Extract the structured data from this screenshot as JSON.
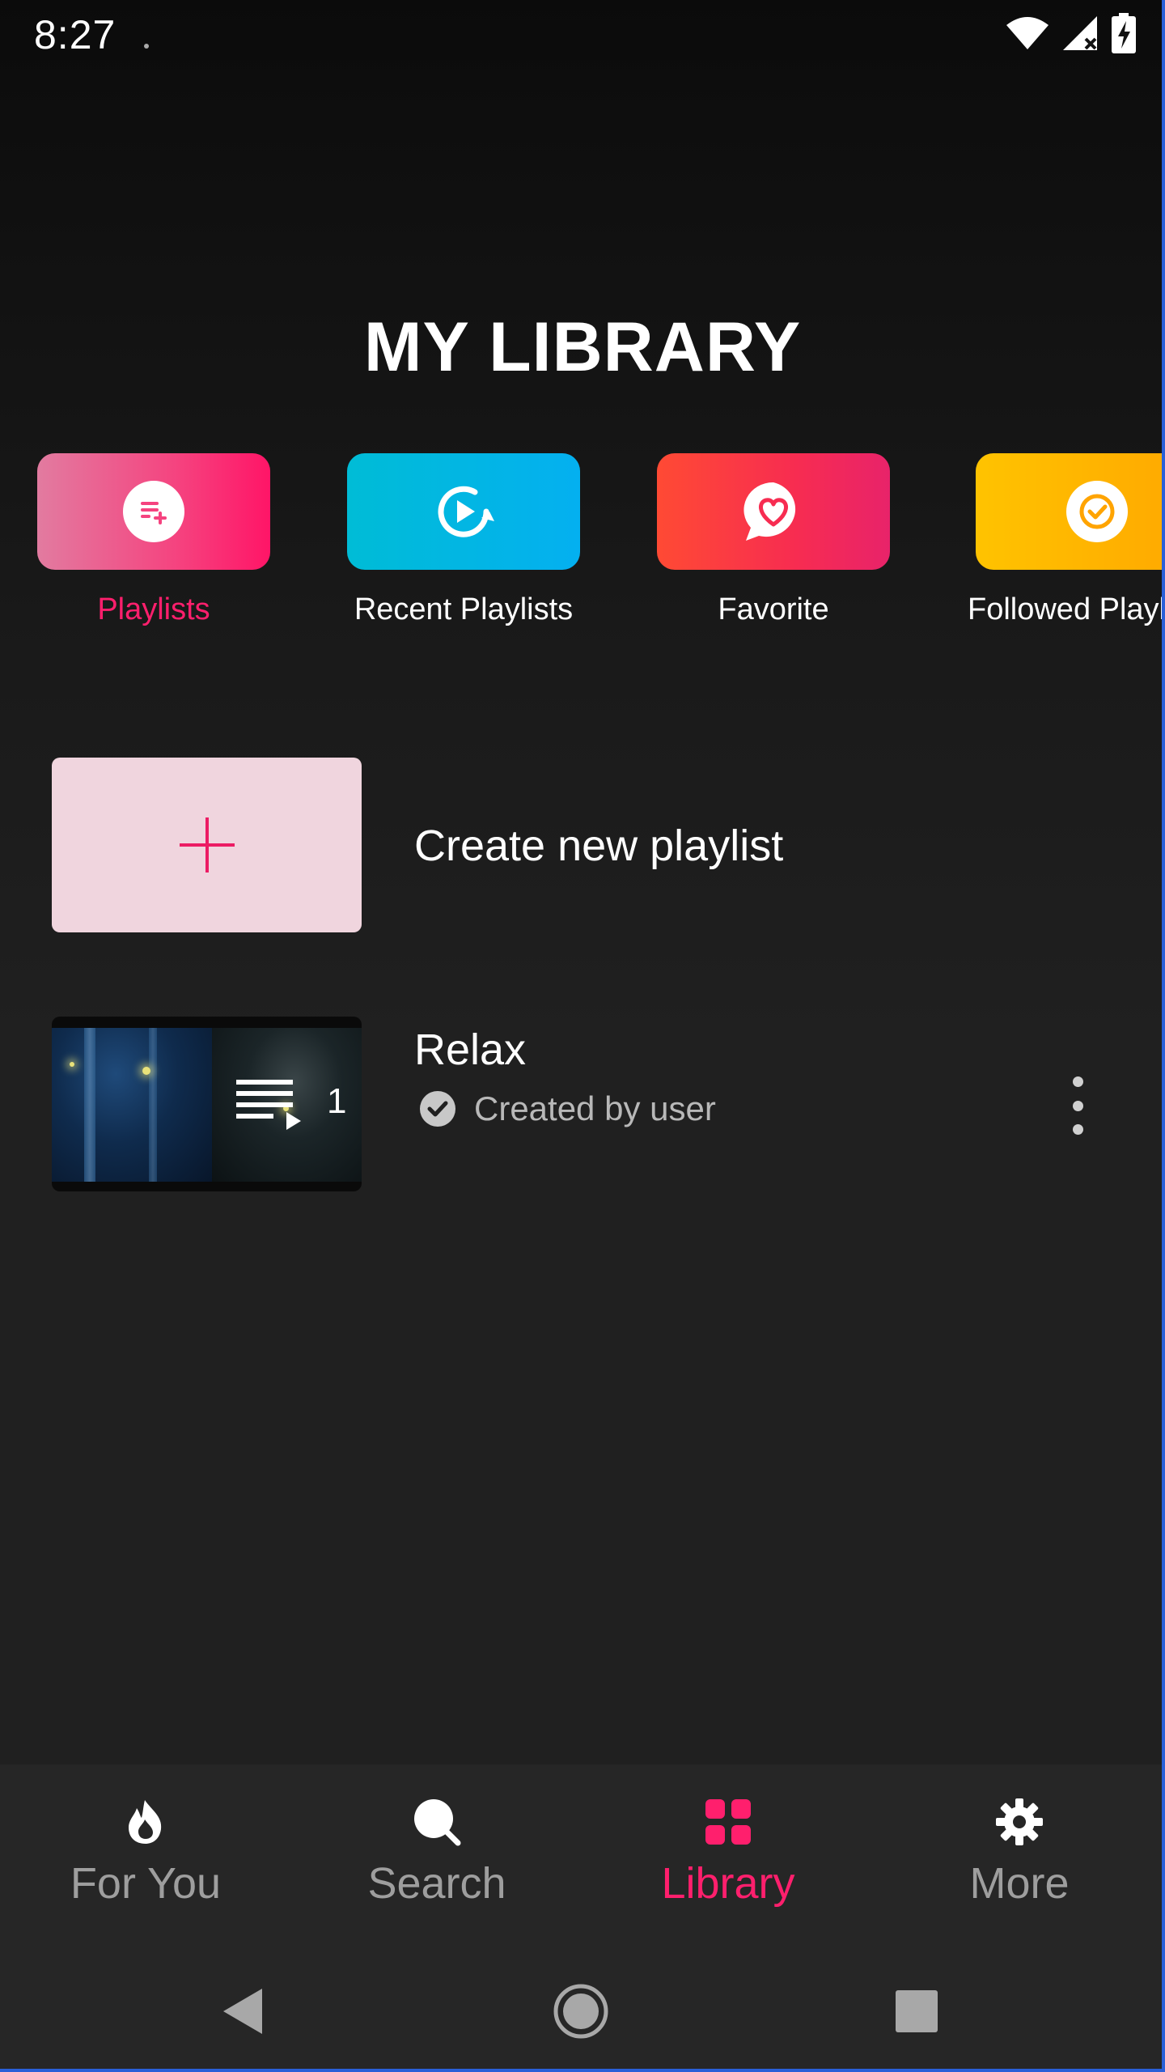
{
  "status_bar": {
    "time": "8:27",
    "icons": [
      "wifi-icon",
      "signal-icon",
      "battery-charging-icon"
    ]
  },
  "header": {
    "title": "MY LIBRARY"
  },
  "categories": [
    {
      "label": "Playlists",
      "icon": "playlist-add-icon",
      "active": true,
      "color": "#ff1f6d"
    },
    {
      "label": "Recent Playlists",
      "icon": "recent-play-icon",
      "active": false,
      "color": "#04b0f0"
    },
    {
      "label": "Favorite",
      "icon": "heart-chat-icon",
      "active": false,
      "color": "#f72c51"
    },
    {
      "label": "Followed Playl",
      "icon": "check-circle-icon",
      "active": false,
      "color": "#ffa400"
    }
  ],
  "create_playlist": {
    "label": "Create new playlist",
    "icon": "plus-icon"
  },
  "playlists": [
    {
      "title": "Relax",
      "subtitle": "Created by user",
      "count": "1"
    }
  ],
  "bottom_nav": [
    {
      "label": "For You",
      "icon": "flame-icon",
      "active": false
    },
    {
      "label": "Search",
      "icon": "search-icon",
      "active": false
    },
    {
      "label": "Library",
      "icon": "grid-icon",
      "active": true
    },
    {
      "label": "More",
      "icon": "gear-icon",
      "active": false
    }
  ],
  "colors": {
    "accent": "#ff1f6d",
    "background": "#1e1e1e",
    "nav_background": "#262626"
  }
}
